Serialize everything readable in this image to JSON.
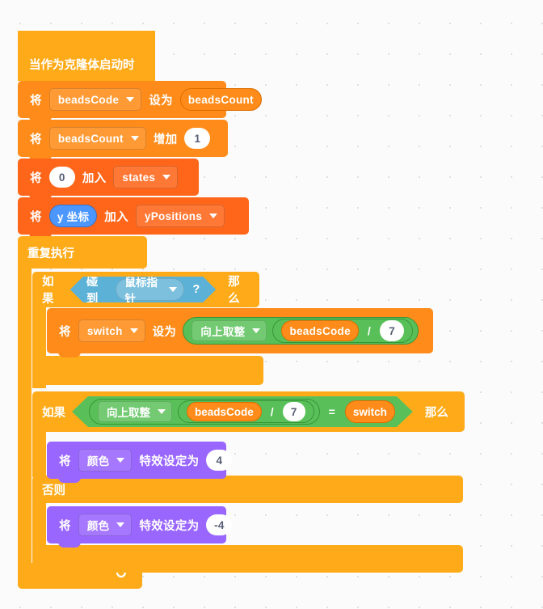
{
  "workspace": {
    "name": "scratch-block-workspace",
    "background_color": "#fbfbfb",
    "grid_dot_color": "#e0e0e0"
  },
  "palette": {
    "events": "#FFAB19",
    "control": "#FFAB19",
    "variables": "#FF8C1A",
    "lists": "#FF661A",
    "looks": "#9966FF",
    "sensing": "#5CB1D6",
    "operators": "#59C059",
    "motion": "#4C97FF"
  },
  "script": {
    "hat": {
      "label": "当作为克隆体启动时"
    },
    "set_beadscode": {
      "prefix": "将",
      "variable": "beadsCode",
      "verb": "设为",
      "value": "beadsCount"
    },
    "change_beadscount": {
      "prefix": "将",
      "variable": "beadsCount",
      "verb": "增加",
      "value": "1"
    },
    "add_to_states": {
      "prefix": "将",
      "value": "0",
      "verb": "加入",
      "list": "states"
    },
    "add_to_ypositions": {
      "prefix": "将",
      "reporter": "y 坐标",
      "verb": "加入",
      "list": "yPositions"
    },
    "forever": {
      "label": "重复执行"
    },
    "if_touching": {
      "if_label": "如果",
      "then_label": "那么",
      "condition_verb": "碰到",
      "condition_target": "鼠标指针",
      "condition_suffix": "?"
    },
    "set_switch": {
      "prefix": "将",
      "variable": "switch",
      "verb": "设为",
      "op_function": "向上取整",
      "op_left": "beadsCode",
      "op_symbol": "/",
      "op_right": "7"
    },
    "if_else": {
      "if_label": "如果",
      "then_label": "那么",
      "else_label": "否则",
      "op_function": "向上取整",
      "op_left": "beadsCode",
      "op_symbol": "/",
      "op_right": "7",
      "compare_symbol": "=",
      "compare_right": "switch"
    },
    "set_color_effect_true": {
      "prefix": "将",
      "effect": "颜色",
      "verb": "特效设定为",
      "value": "4"
    },
    "set_color_effect_false": {
      "prefix": "将",
      "effect": "颜色",
      "verb": "特效设定为",
      "value": "-4"
    },
    "loop_arrow_glyph": "↻"
  }
}
